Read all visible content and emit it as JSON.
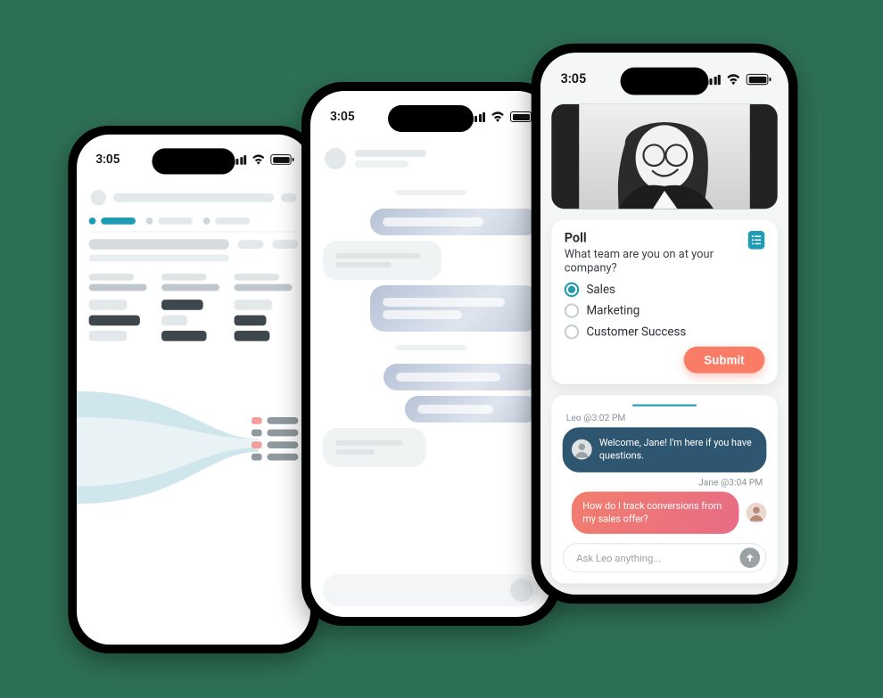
{
  "statusbar": {
    "time": "3:05"
  },
  "colors": {
    "accent_teal": "#1f9bb3",
    "accent_coral": "#f97d66",
    "bubble_navy": "#2f5670",
    "bubble_pink_start": "#f27e6d",
    "bubble_pink_end": "#e76b86",
    "background": "#2e7055"
  },
  "phone1": {
    "legend_colors": [
      "#f49b9b",
      "#8f999e",
      "#f49b9b",
      "#8f999e"
    ]
  },
  "phone3": {
    "poll": {
      "title": "Poll",
      "question": "What team are you on at your company?",
      "options": [
        "Sales",
        "Marketing",
        "Customer Success"
      ],
      "selected_index": 0,
      "submit_label": "Submit"
    },
    "chat": {
      "msg1_meta": "Leo @3:02 PM",
      "msg1_text": "Welcome, Jane! I'm here if you have questions.",
      "msg2_meta": "Jane @3:04 PM",
      "msg2_text": "How do I track conversions from my sales offer?"
    },
    "input": {
      "placeholder": "Ask Leo anything..."
    }
  }
}
